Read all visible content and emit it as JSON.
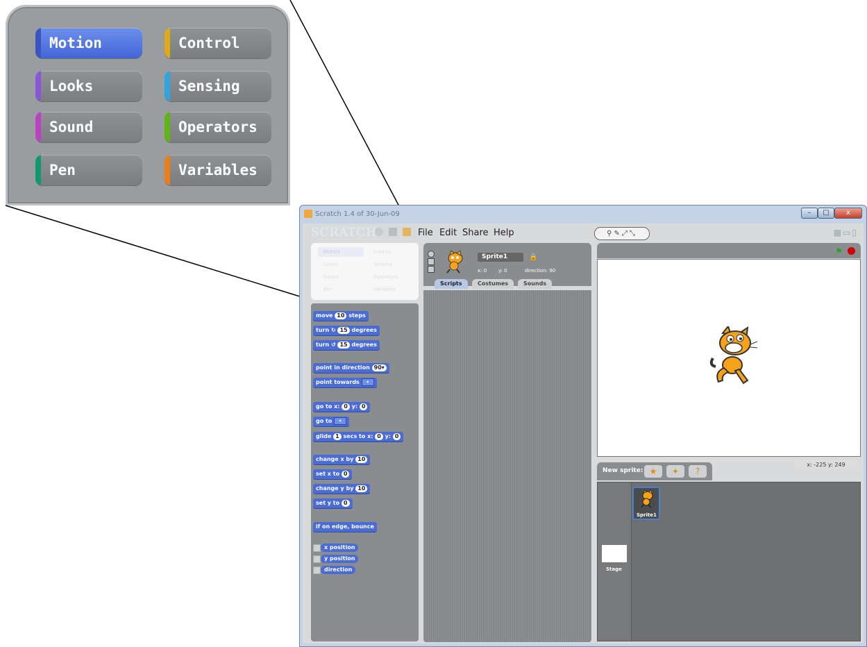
{
  "zoom_categories": [
    {
      "label": "Motion",
      "color": "#4a6cd4",
      "selected": true
    },
    {
      "label": "Control",
      "color": "#e1a91a"
    },
    {
      "label": "Looks",
      "color": "#8a55d7"
    },
    {
      "label": "Sensing",
      "color": "#2ca5e2"
    },
    {
      "label": "Sound",
      "color": "#bb42c3"
    },
    {
      "label": "Operators",
      "color": "#5cb712"
    },
    {
      "label": "Pen",
      "color": "#0e9a6c"
    },
    {
      "label": "Variables",
      "color": "#ee7d16"
    }
  ],
  "window": {
    "title": "Scratch 1.4 of 30-Jun-09",
    "logo": "SCRATCH",
    "menus": [
      "File",
      "Edit",
      "Share",
      "Help"
    ]
  },
  "palette_small": [
    "Motion",
    "Control",
    "Looks",
    "Sensing",
    "Sound",
    "Operators",
    "Pen",
    "Variables"
  ],
  "blocks": {
    "move": {
      "pre": "move",
      "val": "10",
      "post": "steps"
    },
    "turn_cw": {
      "pre": "turn ↻",
      "val": "15",
      "post": "degrees"
    },
    "turn_ccw": {
      "pre": "turn ↺",
      "val": "15",
      "post": "degrees"
    },
    "point_dir": {
      "pre": "point in direction",
      "val": "90▾"
    },
    "point_towards": {
      "pre": "point towards"
    },
    "goto_xy": {
      "pre": "go to x:",
      "x": "0",
      "mid": "y:",
      "y": "0"
    },
    "goto": {
      "pre": "go to"
    },
    "glide": {
      "pre": "glide",
      "secs": "1",
      "mid": "secs to x:",
      "x": "0",
      "mid2": "y:",
      "y": "0"
    },
    "change_x": {
      "pre": "change x by",
      "val": "10"
    },
    "set_x": {
      "pre": "set x to",
      "val": "0"
    },
    "change_y": {
      "pre": "change y by",
      "val": "10"
    },
    "set_y": {
      "pre": "set y to",
      "val": "0"
    },
    "bounce": "if on edge, bounce",
    "reporters": [
      "x position",
      "y position",
      "direction"
    ]
  },
  "sprite": {
    "name": "Sprite1",
    "x_label": "x: 0",
    "y_label": "y: 0",
    "direction_label": "direction: 90"
  },
  "tabs": [
    "Scripts",
    "Costumes",
    "Sounds"
  ],
  "stage": {
    "mouse_x": "x: -225",
    "mouse_y": "y: 249",
    "new_sprite_label": "New sprite:",
    "stage_label": "Stage",
    "sprite_thumb_label": "Sprite1"
  }
}
